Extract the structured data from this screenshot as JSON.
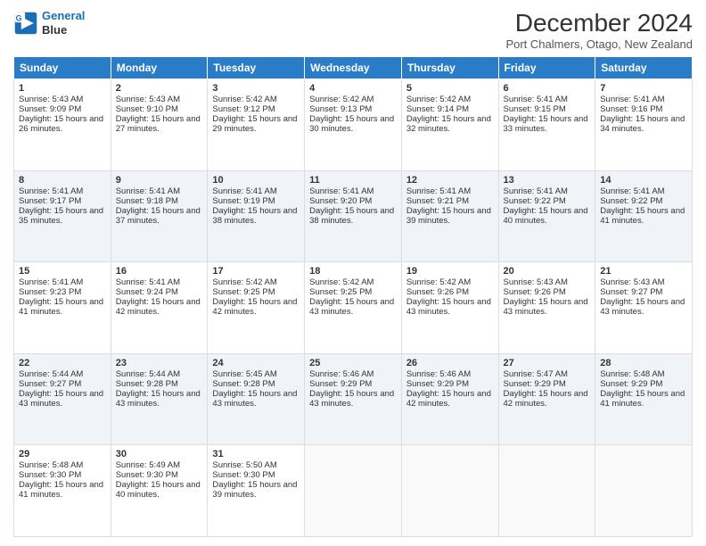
{
  "logo": {
    "line1": "General",
    "line2": "Blue"
  },
  "title": "December 2024",
  "location": "Port Chalmers, Otago, New Zealand",
  "days": [
    "Sunday",
    "Monday",
    "Tuesday",
    "Wednesday",
    "Thursday",
    "Friday",
    "Saturday"
  ],
  "rows": [
    [
      {
        "day": "1",
        "sunrise": "Sunrise: 5:43 AM",
        "sunset": "Sunset: 9:09 PM",
        "daylight": "Daylight: 15 hours and 26 minutes."
      },
      {
        "day": "2",
        "sunrise": "Sunrise: 5:43 AM",
        "sunset": "Sunset: 9:10 PM",
        "daylight": "Daylight: 15 hours and 27 minutes."
      },
      {
        "day": "3",
        "sunrise": "Sunrise: 5:42 AM",
        "sunset": "Sunset: 9:12 PM",
        "daylight": "Daylight: 15 hours and 29 minutes."
      },
      {
        "day": "4",
        "sunrise": "Sunrise: 5:42 AM",
        "sunset": "Sunset: 9:13 PM",
        "daylight": "Daylight: 15 hours and 30 minutes."
      },
      {
        "day": "5",
        "sunrise": "Sunrise: 5:42 AM",
        "sunset": "Sunset: 9:14 PM",
        "daylight": "Daylight: 15 hours and 32 minutes."
      },
      {
        "day": "6",
        "sunrise": "Sunrise: 5:41 AM",
        "sunset": "Sunset: 9:15 PM",
        "daylight": "Daylight: 15 hours and 33 minutes."
      },
      {
        "day": "7",
        "sunrise": "Sunrise: 5:41 AM",
        "sunset": "Sunset: 9:16 PM",
        "daylight": "Daylight: 15 hours and 34 minutes."
      }
    ],
    [
      {
        "day": "8",
        "sunrise": "Sunrise: 5:41 AM",
        "sunset": "Sunset: 9:17 PM",
        "daylight": "Daylight: 15 hours and 35 minutes."
      },
      {
        "day": "9",
        "sunrise": "Sunrise: 5:41 AM",
        "sunset": "Sunset: 9:18 PM",
        "daylight": "Daylight: 15 hours and 37 minutes."
      },
      {
        "day": "10",
        "sunrise": "Sunrise: 5:41 AM",
        "sunset": "Sunset: 9:19 PM",
        "daylight": "Daylight: 15 hours and 38 minutes."
      },
      {
        "day": "11",
        "sunrise": "Sunrise: 5:41 AM",
        "sunset": "Sunset: 9:20 PM",
        "daylight": "Daylight: 15 hours and 38 minutes."
      },
      {
        "day": "12",
        "sunrise": "Sunrise: 5:41 AM",
        "sunset": "Sunset: 9:21 PM",
        "daylight": "Daylight: 15 hours and 39 minutes."
      },
      {
        "day": "13",
        "sunrise": "Sunrise: 5:41 AM",
        "sunset": "Sunset: 9:22 PM",
        "daylight": "Daylight: 15 hours and 40 minutes."
      },
      {
        "day": "14",
        "sunrise": "Sunrise: 5:41 AM",
        "sunset": "Sunset: 9:22 PM",
        "daylight": "Daylight: 15 hours and 41 minutes."
      }
    ],
    [
      {
        "day": "15",
        "sunrise": "Sunrise: 5:41 AM",
        "sunset": "Sunset: 9:23 PM",
        "daylight": "Daylight: 15 hours and 41 minutes."
      },
      {
        "day": "16",
        "sunrise": "Sunrise: 5:41 AM",
        "sunset": "Sunset: 9:24 PM",
        "daylight": "Daylight: 15 hours and 42 minutes."
      },
      {
        "day": "17",
        "sunrise": "Sunrise: 5:42 AM",
        "sunset": "Sunset: 9:25 PM",
        "daylight": "Daylight: 15 hours and 42 minutes."
      },
      {
        "day": "18",
        "sunrise": "Sunrise: 5:42 AM",
        "sunset": "Sunset: 9:25 PM",
        "daylight": "Daylight: 15 hours and 43 minutes."
      },
      {
        "day": "19",
        "sunrise": "Sunrise: 5:42 AM",
        "sunset": "Sunset: 9:26 PM",
        "daylight": "Daylight: 15 hours and 43 minutes."
      },
      {
        "day": "20",
        "sunrise": "Sunrise: 5:43 AM",
        "sunset": "Sunset: 9:26 PM",
        "daylight": "Daylight: 15 hours and 43 minutes."
      },
      {
        "day": "21",
        "sunrise": "Sunrise: 5:43 AM",
        "sunset": "Sunset: 9:27 PM",
        "daylight": "Daylight: 15 hours and 43 minutes."
      }
    ],
    [
      {
        "day": "22",
        "sunrise": "Sunrise: 5:44 AM",
        "sunset": "Sunset: 9:27 PM",
        "daylight": "Daylight: 15 hours and 43 minutes."
      },
      {
        "day": "23",
        "sunrise": "Sunrise: 5:44 AM",
        "sunset": "Sunset: 9:28 PM",
        "daylight": "Daylight: 15 hours and 43 minutes."
      },
      {
        "day": "24",
        "sunrise": "Sunrise: 5:45 AM",
        "sunset": "Sunset: 9:28 PM",
        "daylight": "Daylight: 15 hours and 43 minutes."
      },
      {
        "day": "25",
        "sunrise": "Sunrise: 5:46 AM",
        "sunset": "Sunset: 9:29 PM",
        "daylight": "Daylight: 15 hours and 43 minutes."
      },
      {
        "day": "26",
        "sunrise": "Sunrise: 5:46 AM",
        "sunset": "Sunset: 9:29 PM",
        "daylight": "Daylight: 15 hours and 42 minutes."
      },
      {
        "day": "27",
        "sunrise": "Sunrise: 5:47 AM",
        "sunset": "Sunset: 9:29 PM",
        "daylight": "Daylight: 15 hours and 42 minutes."
      },
      {
        "day": "28",
        "sunrise": "Sunrise: 5:48 AM",
        "sunset": "Sunset: 9:29 PM",
        "daylight": "Daylight: 15 hours and 41 minutes."
      }
    ],
    [
      {
        "day": "29",
        "sunrise": "Sunrise: 5:48 AM",
        "sunset": "Sunset: 9:30 PM",
        "daylight": "Daylight: 15 hours and 41 minutes."
      },
      {
        "day": "30",
        "sunrise": "Sunrise: 5:49 AM",
        "sunset": "Sunset: 9:30 PM",
        "daylight": "Daylight: 15 hours and 40 minutes."
      },
      {
        "day": "31",
        "sunrise": "Sunrise: 5:50 AM",
        "sunset": "Sunset: 9:30 PM",
        "daylight": "Daylight: 15 hours and 39 minutes."
      },
      null,
      null,
      null,
      null
    ]
  ]
}
